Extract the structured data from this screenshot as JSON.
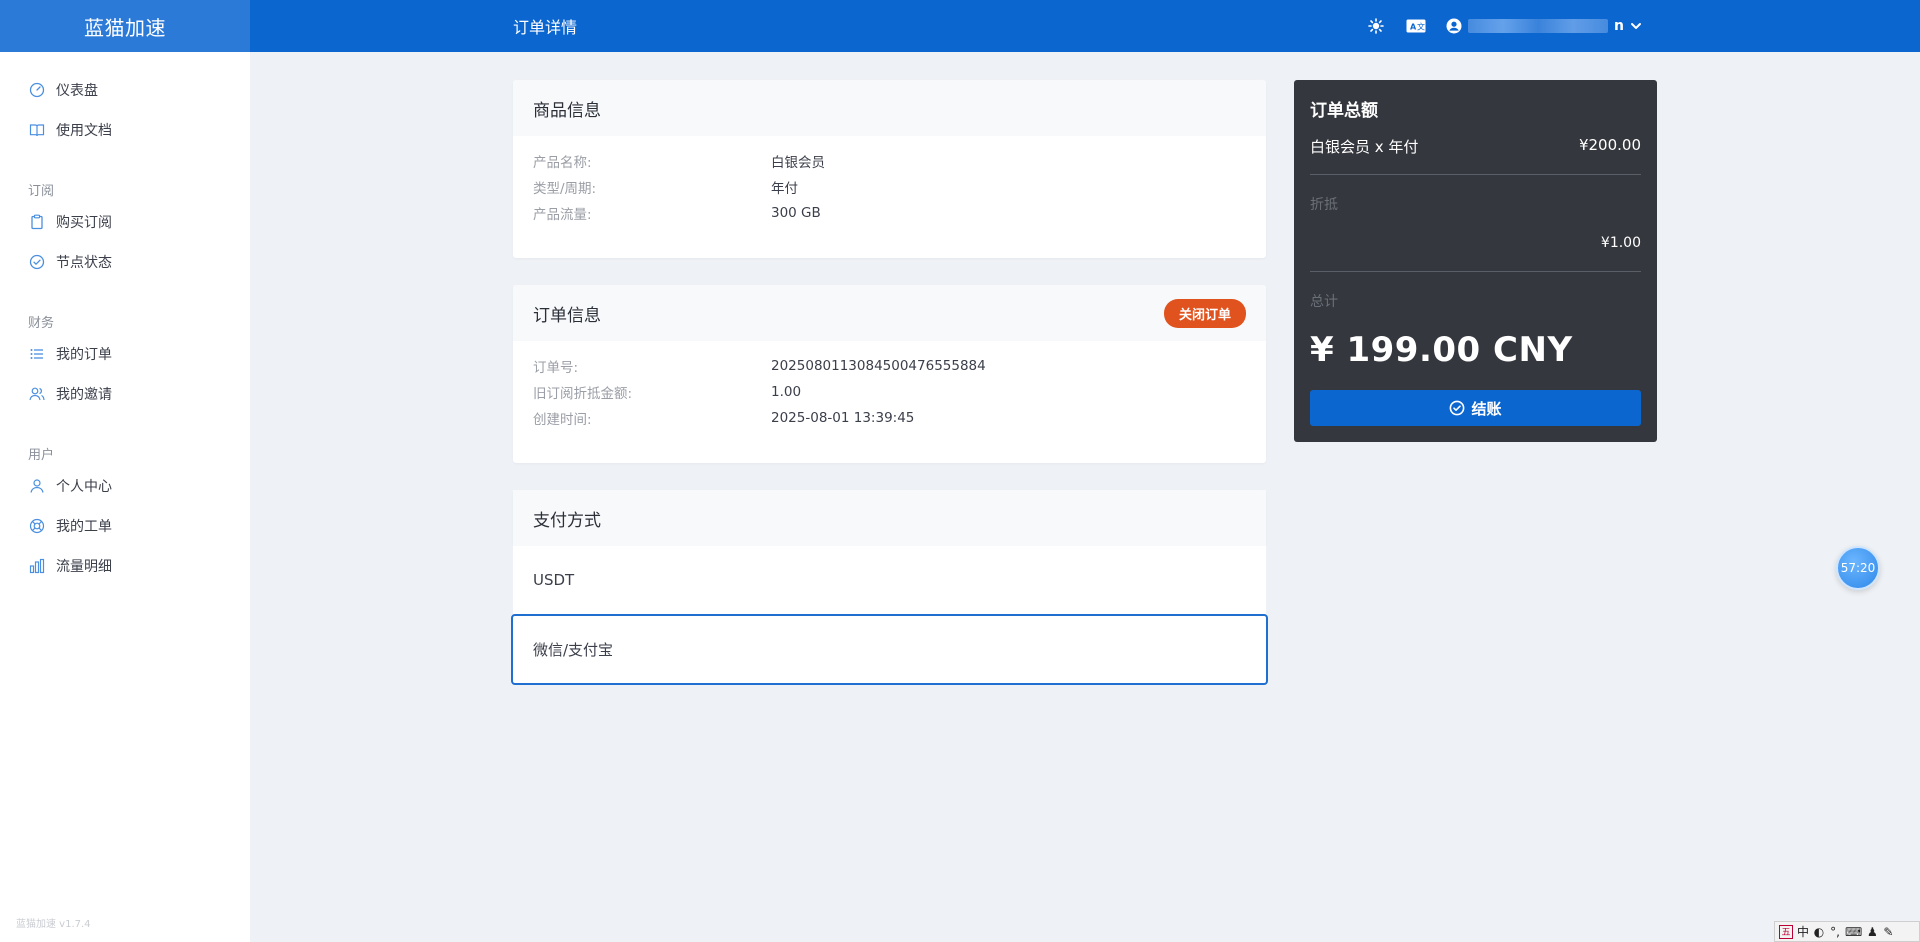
{
  "header": {
    "brand": "蓝猫加速",
    "page_title": "订单详情",
    "user_suffix": "n"
  },
  "sidebar": {
    "items": [
      {
        "label": "仪表盘",
        "icon": "dashboard-icon"
      },
      {
        "label": "使用文档",
        "icon": "book-icon"
      }
    ],
    "groups": [
      {
        "title": "订阅",
        "items": [
          {
            "label": "购买订阅",
            "icon": "clipboard-icon"
          },
          {
            "label": "节点状态",
            "icon": "check-circle-icon"
          }
        ]
      },
      {
        "title": "财务",
        "items": [
          {
            "label": "我的订单",
            "icon": "list-icon"
          },
          {
            "label": "我的邀请",
            "icon": "users-icon"
          }
        ]
      },
      {
        "title": "用户",
        "items": [
          {
            "label": "个人中心",
            "icon": "user-icon"
          },
          {
            "label": "我的工单",
            "icon": "lifebuoy-icon"
          },
          {
            "label": "流量明细",
            "icon": "bar-chart-icon"
          }
        ]
      }
    ],
    "version": "蓝猫加速 v1.7.4"
  },
  "product": {
    "title": "商品信息",
    "rows": [
      {
        "k": "产品名称:",
        "v": "白银会员"
      },
      {
        "k": "类型/周期:",
        "v": "年付"
      },
      {
        "k": "产品流量:",
        "v": "300 GB"
      }
    ]
  },
  "order": {
    "title": "订单信息",
    "close_label": "关闭订单",
    "rows": [
      {
        "k": "订单号:",
        "v": "2025080113084500476555884"
      },
      {
        "k": "旧订阅折抵金额:",
        "v": "1.00"
      },
      {
        "k": "创建时间:",
        "v": "2025-08-01 13:39:45"
      }
    ]
  },
  "payment": {
    "title": "支付方式",
    "options": [
      "USDT",
      "微信/支付宝"
    ],
    "selected": "微信/支付宝"
  },
  "summary": {
    "title": "订单总额",
    "item_label": "白银会员 x 年付",
    "item_price": "¥200.00",
    "discount_label": "折抵",
    "discount_value": "¥1.00",
    "total_label": "总计",
    "total_value": "¥ 199.00 CNY",
    "checkout_label": "结账"
  },
  "timer": "57:20",
  "ime": {
    "chinese_mode": "中"
  },
  "colors": {
    "primary": "#0b66d0",
    "brand_bg": "#2c7ad8",
    "danger": "#e0531e",
    "summary_bg": "#34373d",
    "page_bg": "#eef1f5"
  }
}
